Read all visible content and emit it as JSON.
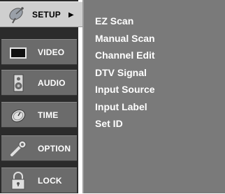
{
  "menu": {
    "items": [
      {
        "label": "SETUP",
        "icon": "satellite-dish-icon",
        "selected": true,
        "arrow": "▶"
      },
      {
        "label": "VIDEO",
        "icon": "screen-icon",
        "selected": false
      },
      {
        "label": "AUDIO",
        "icon": "speaker-icon",
        "selected": false
      },
      {
        "label": "TIME",
        "icon": "clock-icon",
        "selected": false
      },
      {
        "label": "OPTION",
        "icon": "wrench-icon",
        "selected": false
      },
      {
        "label": "LOCK",
        "icon": "padlock-icon",
        "selected": false
      }
    ]
  },
  "submenu": {
    "items": [
      "EZ Scan",
      "Manual Scan",
      "Channel Edit",
      "DTV Signal",
      "Input Source",
      "Input Label",
      "Set ID"
    ]
  },
  "colors": {
    "sidebar_bg": "#2b2b2b",
    "item_bg": "#6b6b6b",
    "selected_bg": "#cfcfcf",
    "panel_bg": "#7a7a7a",
    "text": "#ffffff"
  }
}
